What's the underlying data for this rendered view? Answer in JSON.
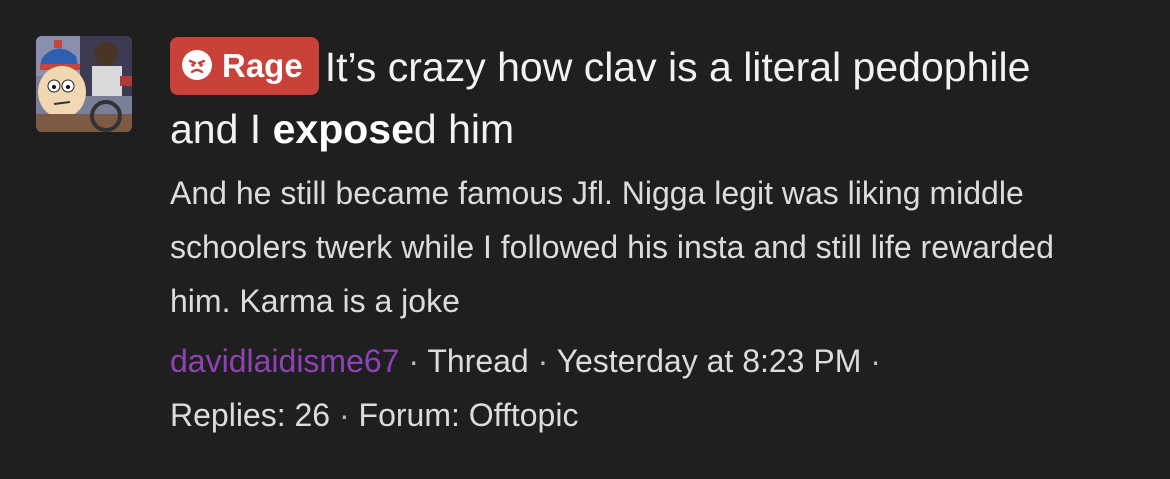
{
  "result": {
    "prefix_label": "Rage",
    "prefix_icon": "angry-face-icon",
    "prefix_color": "#c94138",
    "title_before": "It’s crazy how clav is a literal pedophile and I ",
    "title_highlight": "expose",
    "title_after": "d him",
    "snippet": "And he still became famous Jfl. Nigga legit was liking middle schoolers twerk while I followed his insta and still life rewarded him. Karma is a joke",
    "author": "davidlaidisme67",
    "author_color": "#8f42b5",
    "content_type": "Thread",
    "date": "Yesterday at 8:23 PM",
    "replies": "Replies: 26",
    "forum": "Forum: Offtopic",
    "separator": "·"
  }
}
